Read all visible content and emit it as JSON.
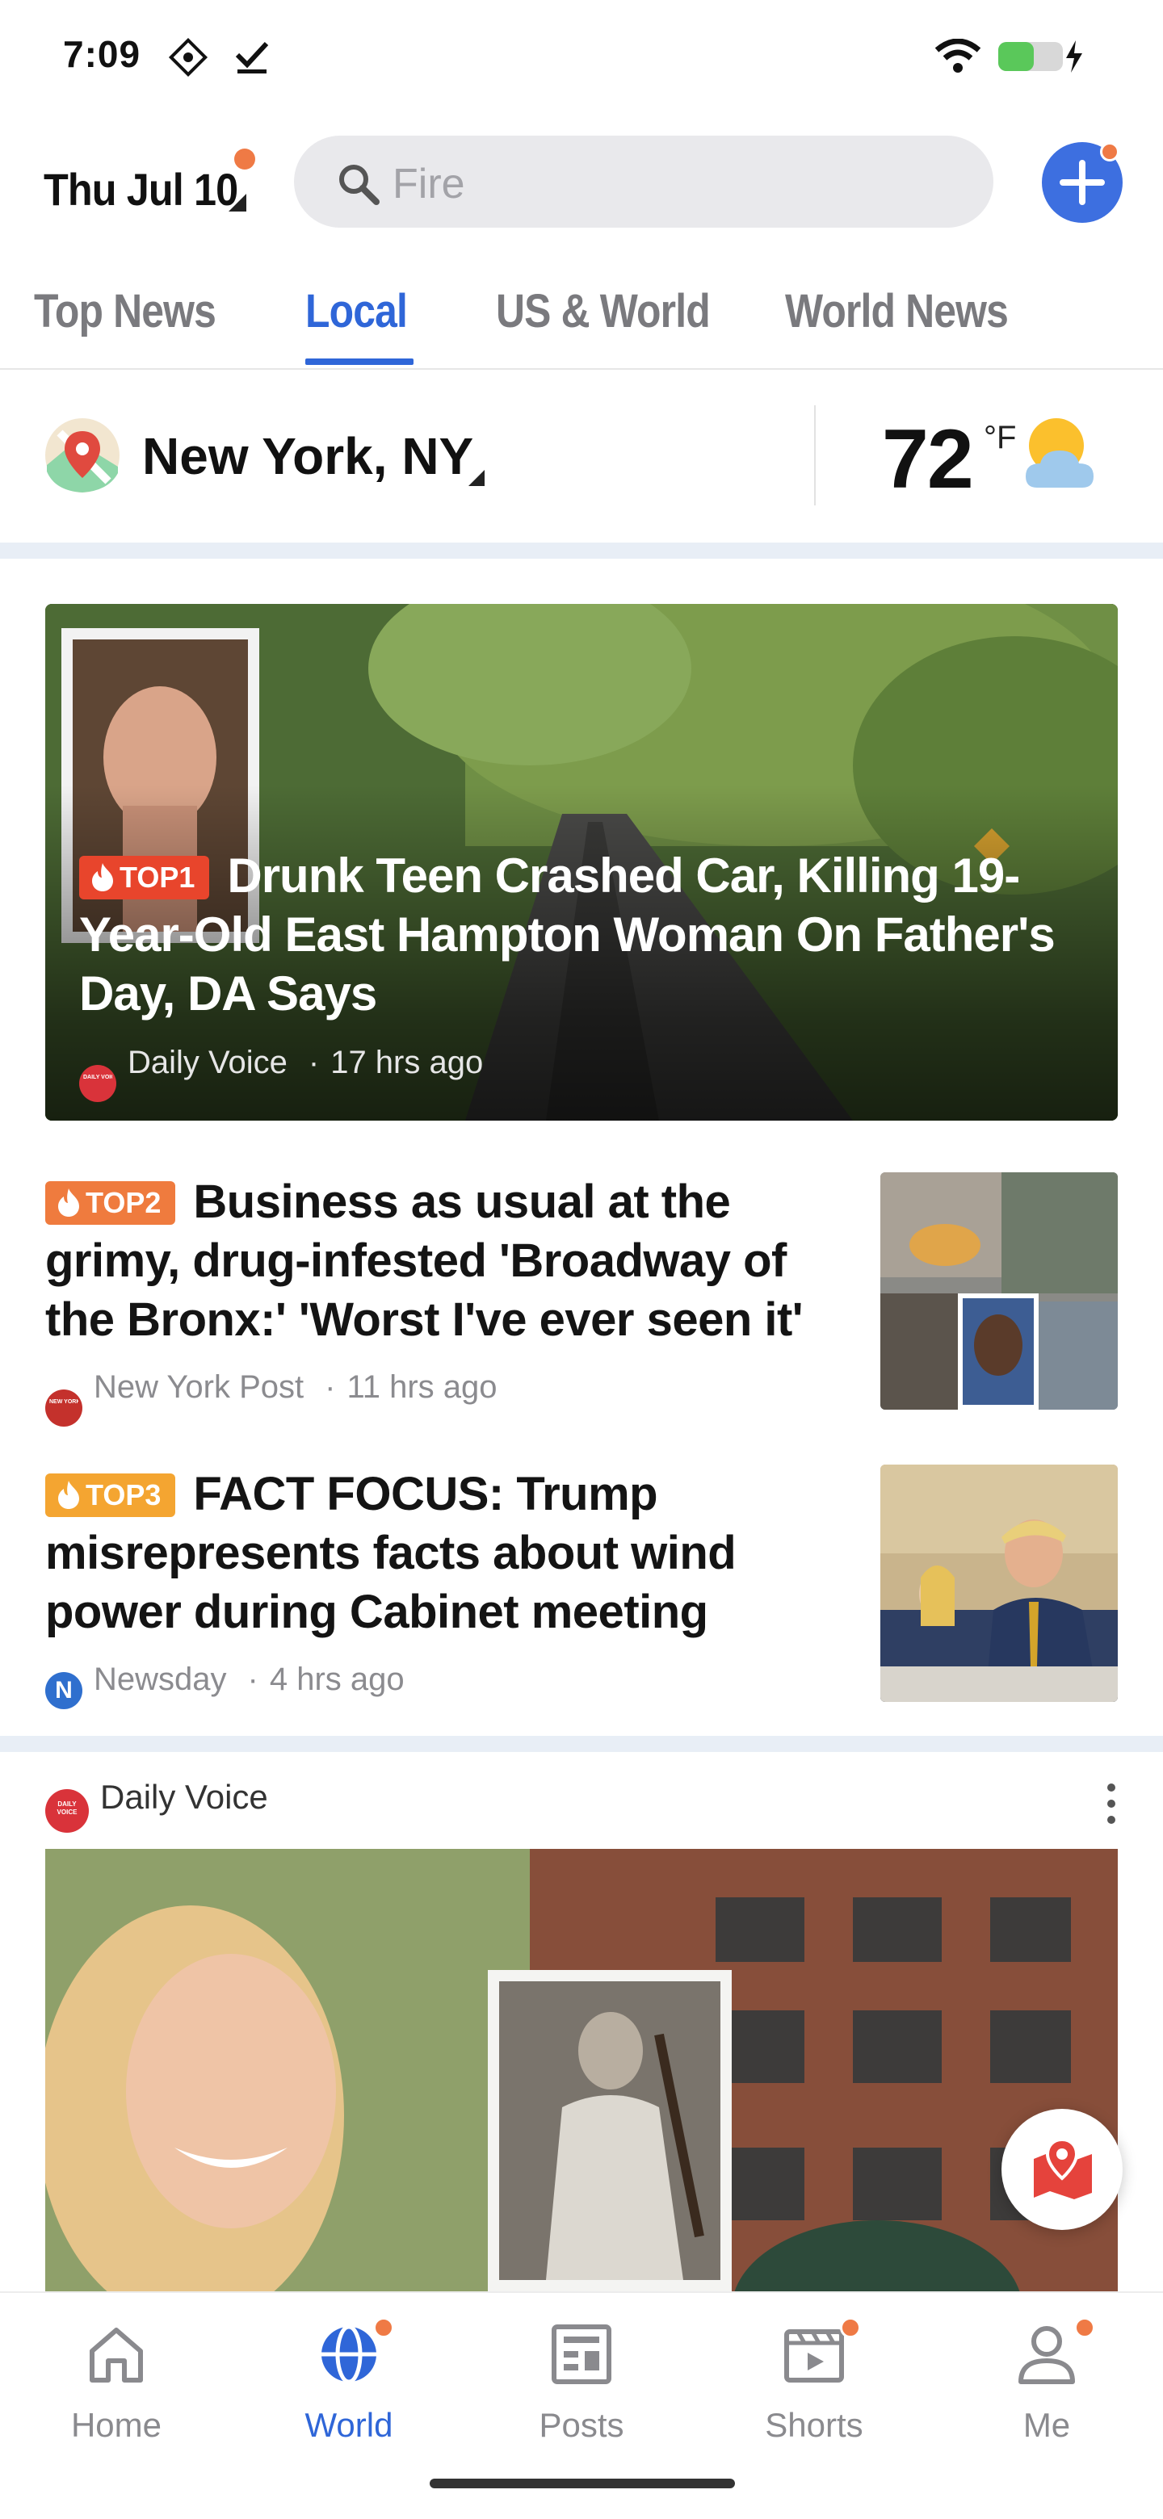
{
  "status_bar": {
    "time": "7:09"
  },
  "header": {
    "date": "Thu Jul 10",
    "search_placeholder": "Fire"
  },
  "tabs": [
    {
      "label": "Top News",
      "active": false
    },
    {
      "label": "Local",
      "active": true
    },
    {
      "label": "US & World",
      "active": false
    },
    {
      "label": "World News",
      "active": false
    }
  ],
  "location": {
    "name": "New York, NY",
    "temperature": "72",
    "unit": "°F"
  },
  "hero": {
    "badge": "TOP1",
    "title": "Drunk Teen Crashed Car, Killing 19-Year-Old East Hampton Woman On Father's Day, DA Says",
    "source": "Daily Voice",
    "time": "17 hrs ago",
    "source_logo_text": "DAILY VOICE"
  },
  "news": [
    {
      "badge": "TOP2",
      "title": "Business as usual at the grimy, drug-infested 'Broadway of the Bronx:' 'Worst I've ever seen it'",
      "source": "New York Post",
      "time": "11 hrs ago",
      "source_logo_text": "NEW YORK POST"
    },
    {
      "badge": "TOP3",
      "title": "FACT FOCUS: Trump misrepresents facts about wind power during Cabinet meeting",
      "source": "Newsday",
      "time": "4 hrs ago",
      "source_logo_text": "N"
    }
  ],
  "post": {
    "source": "Daily Voice",
    "source_logo_text": "DAILY VOICE"
  },
  "bottom_nav": [
    {
      "label": "Home",
      "icon": "home-icon",
      "active": false,
      "dot": false
    },
    {
      "label": "World",
      "icon": "globe-icon",
      "active": true,
      "dot": true
    },
    {
      "label": "Posts",
      "icon": "posts-icon",
      "active": false,
      "dot": false
    },
    {
      "label": "Shorts",
      "icon": "shorts-icon",
      "active": false,
      "dot": true
    },
    {
      "label": "Me",
      "icon": "person-icon",
      "active": false,
      "dot": true
    }
  ],
  "colors": {
    "accent": "#2f66d8",
    "notification_dot": "#ef7a45",
    "top1": "#e8452c",
    "top2": "#ef7b3e",
    "top3": "#f4a531"
  }
}
